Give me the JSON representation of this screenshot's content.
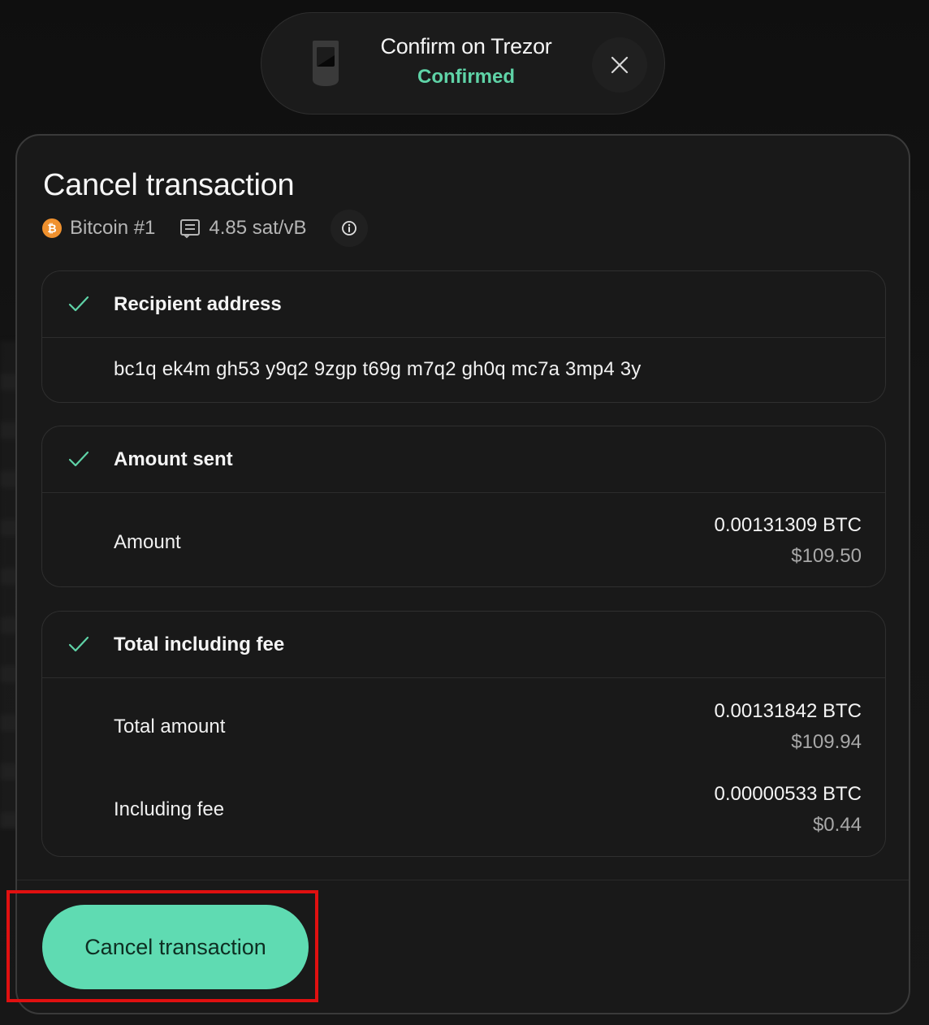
{
  "device_prompt": {
    "title": "Confirm on Trezor",
    "status": "Confirmed",
    "status_color": "#5fd3a7"
  },
  "card": {
    "title": "Cancel transaction",
    "account": "Bitcoin #1",
    "fee_rate": "4.85 sat/vB"
  },
  "recipient": {
    "heading": "Recipient address",
    "address": "bc1q ek4m gh53 y9q2 9zgp t69g m7q2 gh0q mc7a 3mp4 3y"
  },
  "amount_sent": {
    "heading": "Amount sent",
    "label": "Amount",
    "crypto": "0.00131309 BTC",
    "fiat": "$109.50"
  },
  "total": {
    "heading": "Total including fee",
    "total_label": "Total amount",
    "total_crypto": "0.00131842 BTC",
    "total_fiat": "$109.94",
    "fee_label": "Including fee",
    "fee_crypto": "0.00000533 BTC",
    "fee_fiat": "$0.44"
  },
  "actions": {
    "cancel_label": "Cancel transaction",
    "accent": "#5fdbb2"
  }
}
